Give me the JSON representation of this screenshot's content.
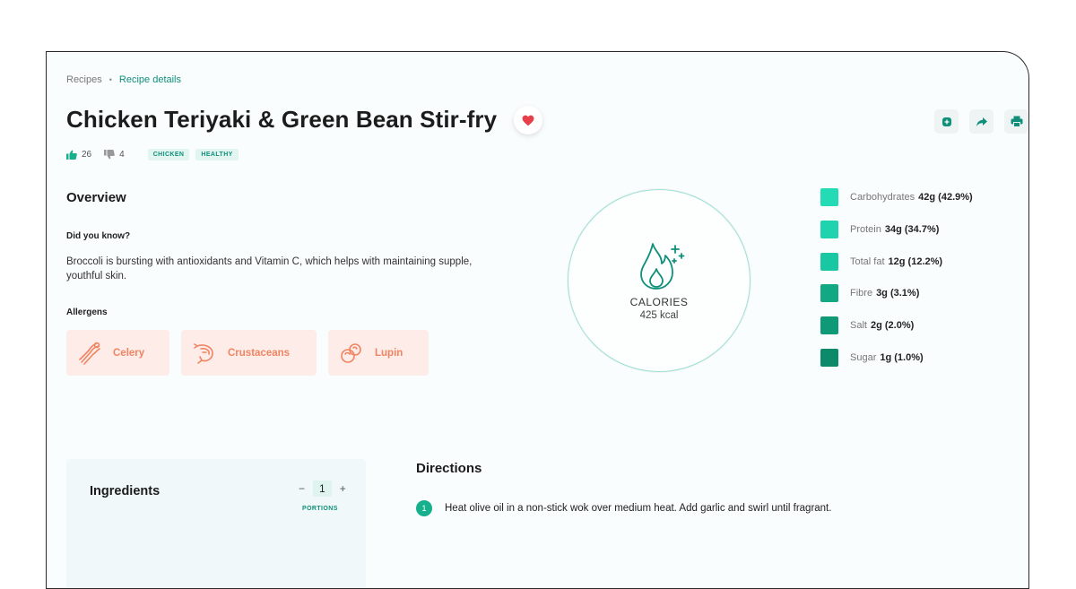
{
  "breadcrumb": {
    "items": [
      "Recipes",
      "Recipe details"
    ],
    "separator": "•"
  },
  "recipe": {
    "title": "Chicken Teriyaki & Green Bean Stir-fry",
    "likes": "26",
    "dislikes": "4",
    "tags": [
      "CHICKEN",
      "HEALTHY"
    ]
  },
  "actions": [
    "add-to-list-icon",
    "share-icon",
    "print-icon"
  ],
  "overview": {
    "heading": "Overview",
    "did_you_know_label": "Did you know?",
    "did_you_know_text": "Broccoli is bursting with antioxidants and Vitamin C, which helps with maintaining supple, youthful skin.",
    "allergens_label": "Allergens",
    "allergens": [
      {
        "label": "Celery",
        "icon": "celery-icon"
      },
      {
        "label": "Crustaceans",
        "icon": "shrimp-icon"
      },
      {
        "label": "Lupin",
        "icon": "lupin-icon"
      }
    ]
  },
  "calories": {
    "label": "CALORIES",
    "value": "425 kcal",
    "icon": "flame-icon"
  },
  "nutrients": [
    {
      "name": "Carbohydrates",
      "value": "42g (42.9%)",
      "color": "#23dcb6"
    },
    {
      "name": "Protein",
      "value": "34g (34.7%)",
      "color": "#1fd3ae"
    },
    {
      "name": "Total fat",
      "value": "12g (12.2%)",
      "color": "#19c8a2"
    },
    {
      "name": "Fibre",
      "value": "3g (3.1%)",
      "color": "#12a883"
    },
    {
      "name": "Salt",
      "value": "2g (2.0%)",
      "color": "#0f9a77"
    },
    {
      "name": "Sugar",
      "value": "1g (1.0%)",
      "color": "#0d8a6a"
    }
  ],
  "ingredients": {
    "heading": "Ingredients",
    "portions_value": "1",
    "portions_label": "PORTIONS",
    "minus": "−",
    "plus": "+"
  },
  "directions": {
    "heading": "Directions",
    "steps": [
      {
        "number": "1",
        "text": "Heat olive oil in a non-stick wok over medium heat. Add garlic and swirl until fragrant."
      }
    ]
  },
  "colors": {
    "accent": "#0f8f7a",
    "allergen_bg": "#fdece7",
    "allergen_text": "#f08463",
    "heart": "#e8404b"
  }
}
